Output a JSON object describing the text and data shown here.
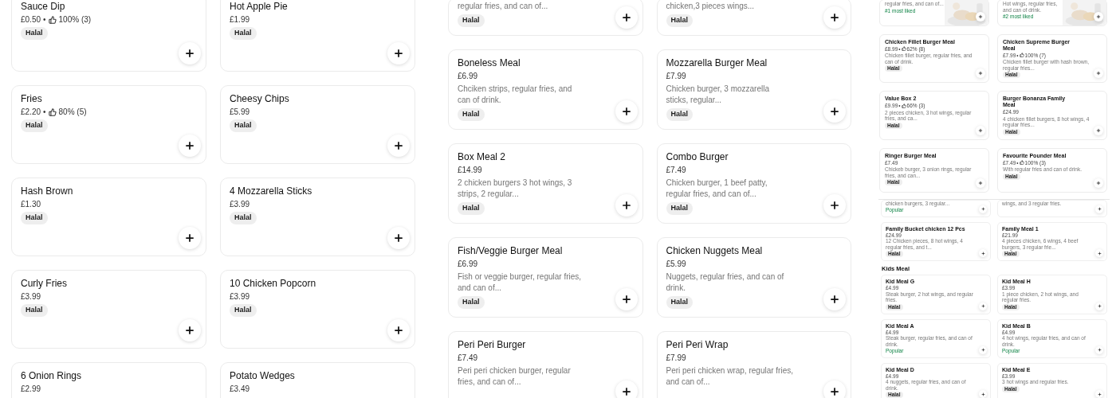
{
  "columns": [
    {
      "sections": [
        {
          "kind": "large",
          "items": [
            {
              "name": "Sauce Dip",
              "price": "£0.50",
              "rating": {
                "separator": "•",
                "value": "100% (3)"
              },
              "tags": [
                {
                  "label": "Halal",
                  "kind": "halal"
                }
              ]
            },
            {
              "name": "Hot Apple Pie",
              "price": "£1.99",
              "tags": [
                {
                  "label": "Halal",
                  "kind": "halal"
                }
              ]
            },
            {
              "name": "Fries",
              "price": "£2.20",
              "rating": {
                "separator": "•",
                "value": "80% (5)"
              },
              "tags": [
                {
                  "label": "Halal",
                  "kind": "halal"
                }
              ]
            },
            {
              "name": "Cheesy Chips",
              "price": "£5.99",
              "tags": [
                {
                  "label": "Halal",
                  "kind": "halal"
                }
              ]
            },
            {
              "name": "Hash Brown",
              "price": "£1.30",
              "tags": [
                {
                  "label": "Halal",
                  "kind": "halal"
                }
              ]
            },
            {
              "name": "4 Mozzarella Sticks",
              "price": "£3.99",
              "tags": [
                {
                  "label": "Halal",
                  "kind": "halal"
                }
              ]
            },
            {
              "name": "Curly Fries",
              "price": "£3.99",
              "tags": [
                {
                  "label": "Halal",
                  "kind": "halal"
                }
              ]
            },
            {
              "name": "10 Chicken Popcorn",
              "price": "£3.99",
              "tags": [
                {
                  "label": "Halal",
                  "kind": "halal"
                }
              ]
            },
            {
              "name": "6 Onion Rings",
              "price": "£2.99"
            },
            {
              "name": "Potato Wedges",
              "price": "£3.49"
            }
          ]
        }
      ]
    },
    {
      "sections": [
        {
          "kind": "large",
          "items": [
            {
              "description": "regular fries, and can of...",
              "tags": [
                {
                  "label": "Halal",
                  "kind": "halal"
                }
              ]
            },
            {
              "description": "chicken,3 pieces wings...",
              "tags": [
                {
                  "label": "Halal",
                  "kind": "halal"
                }
              ]
            },
            {
              "name": "Boneless Meal",
              "price": "£6.99",
              "description": "Chciken strips, regular fries, and can of drink.",
              "tags": [
                {
                  "label": "Halal",
                  "kind": "halal"
                }
              ]
            },
            {
              "name": "Mozzarella Burger Meal",
              "price": "£7.99",
              "description": "Chicken burger, 3 mozzarella sticks, regular...",
              "tags": [
                {
                  "label": "Halal",
                  "kind": "halal"
                }
              ]
            },
            {
              "name": "Box Meal 2",
              "price": "£14.99",
              "description": "2 chicken burgers 3 hot wings, 3 strips, 2 regular...",
              "tags": [
                {
                  "label": "Halal",
                  "kind": "halal"
                }
              ]
            },
            {
              "name": "Combo Burger",
              "price": "£7.49",
              "description": "Chicken burger, 1 beef patty, regular fries, and can of...",
              "tags": [
                {
                  "label": "Halal",
                  "kind": "halal"
                }
              ]
            },
            {
              "name": "Fish/Veggie Burger Meal",
              "price": "£6.99",
              "description": "Fish or veggie burger, regular fries, and can of...",
              "tags": [
                {
                  "label": "Halal",
                  "kind": "halal"
                }
              ]
            },
            {
              "name": "Chicken Nuggets Meal",
              "price": "£5.99",
              "description": "Nuggets, regular fries, and can of drink.",
              "tags": [
                {
                  "label": "Halal",
                  "kind": "halal"
                }
              ]
            },
            {
              "name": "Peri Peri Burger",
              "price": "£7.49",
              "description": "Peri peri chicken burger, regular fries, and can of..."
            },
            {
              "name": "Peri Peri Wrap",
              "price": "£7.99",
              "description": "Peri peri chicken wrap, regular fries, and can of..."
            }
          ]
        }
      ]
    },
    {
      "sections": [
        {
          "kind": "small",
          "items": [
            {
              "description": "regular fries, and can of...",
              "tags": [
                {
                  "label": "#1 most liked",
                  "kind": "liked"
                }
              ]
            },
            {
              "description": "Hot wings, regular fries, and can of drink.",
              "tags": [
                {
                  "label": "#2 most liked",
                  "kind": "liked"
                }
              ]
            },
            {
              "name": "Chicken Fillet Burger Meal",
              "price": "£8.99",
              "rating": {
                "separator": "•",
                "value": "62% (8)"
              },
              "description": "Chicken fillet burger, regular fries, and can of drink.",
              "tags": [
                {
                  "label": "Halal",
                  "kind": "halal"
                }
              ]
            },
            {
              "name": "Chicken Supreme Burger Meal",
              "price": "£7.99",
              "rating": {
                "separator": "•",
                "value": "100% (7)"
              },
              "description": "Chicken fillet burger with hash brown, regular fries...",
              "tags": [
                {
                  "label": "Halal",
                  "kind": "halal"
                }
              ]
            },
            {
              "name": "Value Box 2",
              "price": "£9.99",
              "rating": {
                "separator": "•",
                "value": "66% (3)"
              },
              "description": "2 pieces chicken, 3 hot wings, regular fries, and ca...",
              "tags": [
                {
                  "label": "Halal",
                  "kind": "halal"
                }
              ]
            },
            {
              "name": "Burger Bonanza Family Meal",
              "price": "£24.99",
              "description": "4 chicken fillet burgers, 8 hot wings, 4 regular fries...",
              "tags": [
                {
                  "label": "Halal",
                  "kind": "halal"
                }
              ]
            },
            {
              "name": "Ringer Burger Meal",
              "price": "£7.49",
              "description": "Chickeb burger, 3 onion rings, regular fries, and can...",
              "tags": [
                {
                  "label": "Halal",
                  "kind": "halal"
                }
              ]
            },
            {
              "name": "Favourite Pounder Meal",
              "price": "£7.49",
              "rating": {
                "separator": "•",
                "value": "100% (3)"
              },
              "description": "With regular fries and can of drink.",
              "tags": [
                {
                  "label": "Halal",
                  "kind": "halal"
                }
              ]
            }
          ]
        },
        {
          "kind": "tiny",
          "items": [
            {
              "description": "chicken burgers, 3 regular...",
              "tags": [
                {
                  "label": "Popular",
                  "kind": "popular"
                }
              ]
            },
            {
              "description": "wings, and 3 regular fries."
            },
            {
              "name": "Family Bucket chicken 12 Pcs",
              "price": "£24.99",
              "description": "12 Chicken pieces, 8 hot wings, 4 regular fries, and t...",
              "tags": [
                {
                  "label": "Halal",
                  "kind": "halal"
                }
              ]
            },
            {
              "name": "Family Meal 1",
              "price": "£21.99",
              "description": "4 pieces chicken, 6 wings, 4 beef burgers, 3 regular frie...",
              "tags": [
                {
                  "label": "Halal",
                  "kind": "halal"
                }
              ]
            }
          ]
        },
        {
          "kind": "tiny",
          "heading": "Kids Meal",
          "items": [
            {
              "name": "Kid Meal G",
              "price": "£4.99",
              "description": "Steak burger, 2 hot wings, and regular fries.",
              "tags": [
                {
                  "label": "Halal",
                  "kind": "halal"
                }
              ]
            },
            {
              "name": "Kid Meal H",
              "price": "£3.99",
              "description": "1 piece chicken, 2 hot wings, and regular fries.",
              "tags": [
                {
                  "label": "Halal",
                  "kind": "halal"
                }
              ]
            },
            {
              "name": "Kid Meal A",
              "price": "£4.99",
              "description": "Steak burger, regular fries, and can of drink.",
              "tags": [
                {
                  "label": "Popular",
                  "kind": "popular"
                }
              ]
            },
            {
              "name": "Kid Meal B",
              "price": "£4.99",
              "description": "4 hot wings, regular fries, and can of drink.",
              "tags": [
                {
                  "label": "Popular",
                  "kind": "popular"
                }
              ]
            },
            {
              "name": "Kid Meal D",
              "price": "£4.99",
              "description": "4 nuggets, regular fries, and can of drink.",
              "tags": [
                {
                  "label": "Halal",
                  "kind": "halal"
                }
              ]
            },
            {
              "name": "Kid Meal E",
              "price": "£3.99",
              "description": "3 hot wings and regular fries.",
              "tags": [
                {
                  "label": "Halal",
                  "kind": "halal"
                }
              ]
            }
          ]
        }
      ]
    }
  ]
}
